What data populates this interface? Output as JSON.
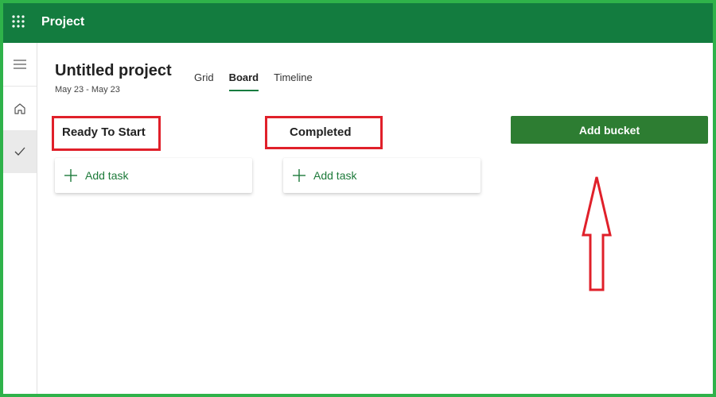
{
  "app": {
    "name": "Project"
  },
  "nav": {
    "items": [
      {
        "icon": "hamburger-icon"
      },
      {
        "icon": "home-icon"
      },
      {
        "icon": "checkmark-icon",
        "selected": true
      }
    ]
  },
  "project": {
    "title": "Untitled project",
    "dates": "May 23 - May 23"
  },
  "tabs": [
    {
      "label": "Grid",
      "active": false
    },
    {
      "label": "Board",
      "active": true
    },
    {
      "label": "Timeline",
      "active": false
    }
  ],
  "buckets": [
    {
      "title": "Ready To Start",
      "add_task_label": "Add task"
    },
    {
      "title": "Completed",
      "add_task_label": "Add task"
    }
  ],
  "add_bucket_label": "Add bucket",
  "colors": {
    "header_bg": "#137c3f",
    "frame_border": "#2fb24a",
    "highlight": "#e0202a",
    "add_bucket_bg": "#2d7d32",
    "accent_text": "#1d7a3a"
  }
}
